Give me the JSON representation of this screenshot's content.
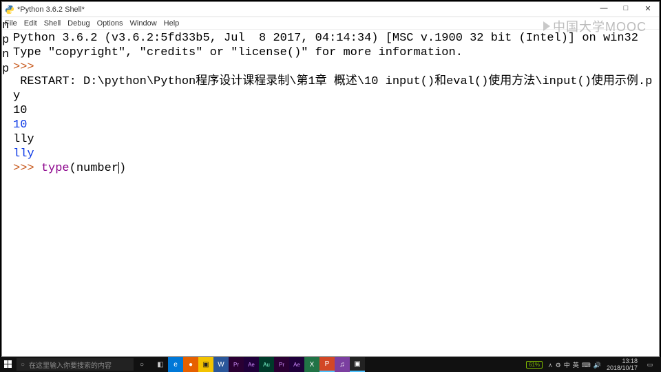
{
  "window": {
    "title": "*Python 3.6.2 Shell*",
    "controls": {
      "min": "—",
      "max": "□",
      "close": "✕"
    }
  },
  "menubar": {
    "items": [
      "File",
      "Edit",
      "Shell",
      "Debug",
      "Options",
      "Window",
      "Help"
    ]
  },
  "left_strip": "n\np\nn\np",
  "shell": {
    "line1": "Python 3.6.2 (v3.6.2:5fd33b5, Jul  8 2017, 04:14:34) [MSC v.1900 32 bit (Intel)] on win32",
    "line2": "Type \"copyright\", \"credits\" or \"license()\" for more information.",
    "prompt1": ">>> ",
    "restart": " RESTART: D:\\python\\Python程序设计课程录制\\第1章 概述\\10 input()和eval()使用方法\\input()使用示例.py ",
    "out1": "10",
    "out2": "10",
    "out3": "lly",
    "out4": "lly",
    "prompt2": ">>> ",
    "input_func": "type",
    "input_paren_open": "(",
    "input_arg": "number",
    "input_paren_close": ")"
  },
  "watermark": {
    "text": "中国大学MOOC"
  },
  "taskbar": {
    "search_placeholder": "在这里输入你要搜索的内容",
    "apps": [
      {
        "cls": "",
        "label": "◧"
      },
      {
        "cls": "ed",
        "label": "e"
      },
      {
        "cls": "ff",
        "label": "●"
      },
      {
        "cls": "fo",
        "label": "▣"
      },
      {
        "cls": "wd",
        "label": "W"
      },
      {
        "cls": "pr",
        "label": "Pr"
      },
      {
        "cls": "ae",
        "label": "Ae"
      },
      {
        "cls": "au",
        "label": "Au"
      },
      {
        "cls": "pr",
        "label": "Pr"
      },
      {
        "cls": "ae",
        "label": "Ae"
      },
      {
        "cls": "ex",
        "label": "X"
      },
      {
        "cls": "pp active",
        "label": "P"
      },
      {
        "cls": "wc",
        "label": "♫"
      },
      {
        "cls": "py active",
        "label": "▣"
      }
    ],
    "battery": "61%",
    "tray": [
      "⋏",
      "⚙",
      "中",
      "英",
      "⌨",
      "🔊"
    ],
    "time": "13:18",
    "date": "2018/10/17"
  }
}
